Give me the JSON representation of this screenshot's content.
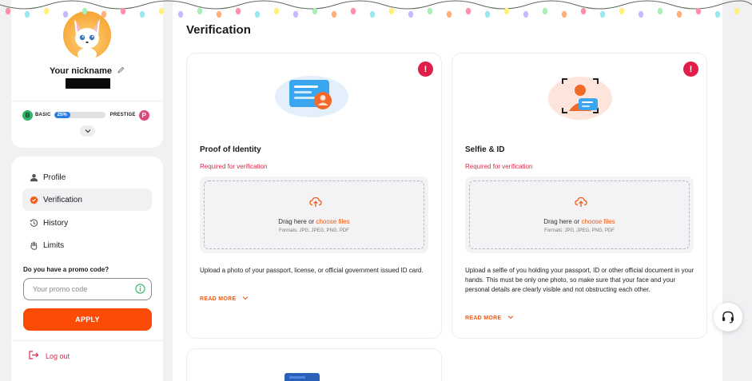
{
  "profile": {
    "nickname": "Your nickname",
    "level": {
      "from_badge": "B",
      "from_label": "BASIC",
      "progress_text": "25%",
      "progress": 0.25,
      "to_badge": "P",
      "to_label": "PRESTIGE"
    }
  },
  "nav": {
    "items": [
      {
        "label": "Profile",
        "icon": "user-icon"
      },
      {
        "label": "Verification",
        "icon": "badge-check-icon"
      },
      {
        "label": "History",
        "icon": "history-icon"
      },
      {
        "label": "Limits",
        "icon": "hand-icon"
      }
    ],
    "active": "Verification"
  },
  "promo": {
    "label": "Do you have a promo code?",
    "placeholder": "Your promo code",
    "apply_label": "APPLY"
  },
  "logout_label": "Log out",
  "main": {
    "title": "Verification",
    "cards": [
      {
        "title": "Proof of Identity",
        "required": "Required for verification",
        "drop_text": "Drag here or ",
        "drop_link": "choose files",
        "formats": "Formats: JPG, JPEG, PNG, PDF",
        "description": "Upload a photo of your passport, license, or official government issued ID card.",
        "read_more": "READ MORE",
        "alert": "!"
      },
      {
        "title": "Selfie & ID",
        "required": "Required for verification",
        "drop_text": "Drag here or ",
        "drop_link": "choose files",
        "formats": "Formats: JPG, JPEG, PNG, PDF",
        "description": "Upload a selfie of you holding your passport, ID or other official document in your hands. This must be only one photo, so make sure that your face and your personal details are clearly visible and not obstructing each other.",
        "read_more": "READ MORE",
        "alert": "!"
      }
    ]
  },
  "colors": {
    "accent": "#fb4b06",
    "danger": "#e01e4a",
    "link": "#f05a14",
    "progress": "#2a7de1"
  }
}
